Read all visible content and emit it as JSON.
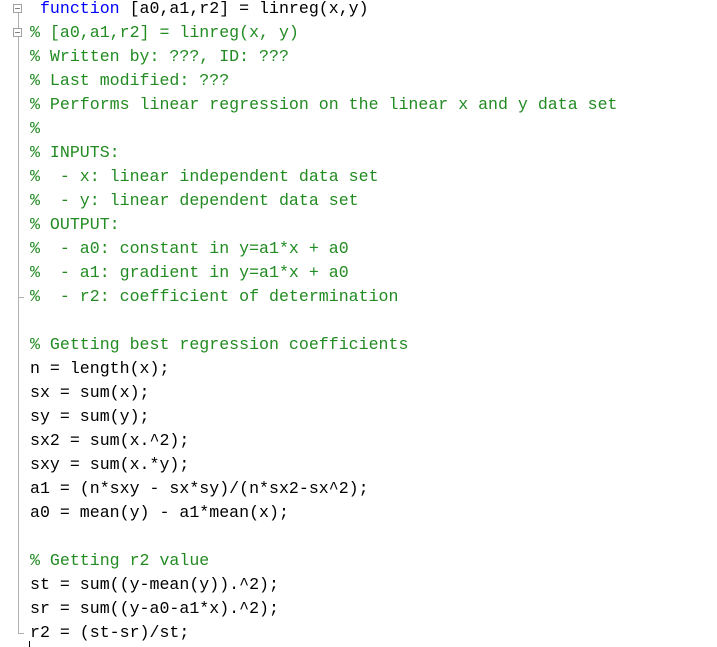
{
  "editor": {
    "colors": {
      "keyword": "#0000ff",
      "comment": "#228b22",
      "text": "#000000"
    },
    "lines": [
      [
        {
          "t": " ",
          "c": "tx"
        },
        {
          "t": "function",
          "c": "kw"
        },
        {
          "t": " [a0,a1,r2] = linreg(x,y)",
          "c": "tx"
        }
      ],
      [
        {
          "t": "% [a0,a1,r2] = linreg(x, y)",
          "c": "cm"
        }
      ],
      [
        {
          "t": "% Written by: ???, ID: ???",
          "c": "cm"
        }
      ],
      [
        {
          "t": "% Last modified: ???",
          "c": "cm"
        }
      ],
      [
        {
          "t": "% Performs linear regression on the linear x and y data set",
          "c": "cm"
        }
      ],
      [
        {
          "t": "%",
          "c": "cm"
        }
      ],
      [
        {
          "t": "% INPUTS:",
          "c": "cm"
        }
      ],
      [
        {
          "t": "%  - x: linear independent data set",
          "c": "cm"
        }
      ],
      [
        {
          "t": "%  - y: linear dependent data set",
          "c": "cm"
        }
      ],
      [
        {
          "t": "% OUTPUT:",
          "c": "cm"
        }
      ],
      [
        {
          "t": "%  - a0: constant in y=a1*x + a0",
          "c": "cm"
        }
      ],
      [
        {
          "t": "%  - a1: gradient in y=a1*x + a0",
          "c": "cm"
        }
      ],
      [
        {
          "t": "%  - r2: coefficient of determination",
          "c": "cm"
        }
      ],
      [],
      [
        {
          "t": "% Getting best regression coefficients",
          "c": "cm"
        }
      ],
      [
        {
          "t": "n = length(x);",
          "c": "tx"
        }
      ],
      [
        {
          "t": "sx = sum(x);",
          "c": "tx"
        }
      ],
      [
        {
          "t": "sy = sum(y);",
          "c": "tx"
        }
      ],
      [
        {
          "t": "sx2 = sum(x.^2);",
          "c": "tx"
        }
      ],
      [
        {
          "t": "sxy = sum(x.*y);",
          "c": "tx"
        }
      ],
      [
        {
          "t": "a1 = (n*sxy - sx*sy)/(n*sx2-sx^2);",
          "c": "tx"
        }
      ],
      [
        {
          "t": "a0 = mean(y) - a1*mean(x);",
          "c": "tx"
        }
      ],
      [],
      [
        {
          "t": "% Getting r2 value",
          "c": "cm"
        }
      ],
      [
        {
          "t": "st = sum((y-mean(y)).^2);",
          "c": "tx"
        }
      ],
      [
        {
          "t": "sr = sum((y-a0-a1*x).^2);",
          "c": "tx"
        }
      ],
      [
        {
          "t": "r2 = (st-sr)/st;",
          "c": "tx"
        }
      ]
    ]
  }
}
